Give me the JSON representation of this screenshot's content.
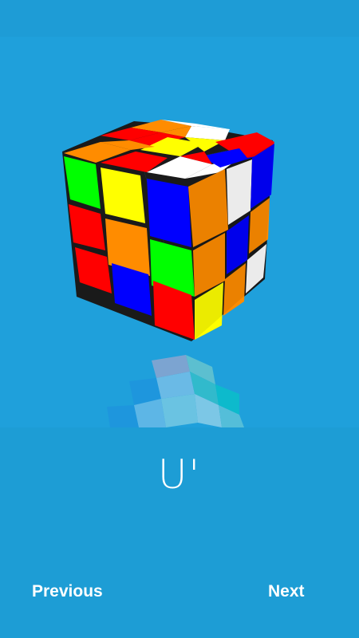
{
  "move": {
    "notation": "U'"
  },
  "navigation": {
    "previous_label": "Previous",
    "next_label": "Next"
  },
  "colors": {
    "background": "#1fa0db",
    "top_bar": "#1e9cd6",
    "bottom_panel": "#1d9dd5",
    "text": "#ffffff",
    "cube_red": "#ff0000",
    "cube_orange": "#ff8c00",
    "cube_yellow": "#ffff00",
    "cube_green": "#00ff00",
    "cube_blue": "#0000ff",
    "cube_white": "#ffffff"
  },
  "cube": {
    "left_face": [
      [
        "green",
        "yellow",
        "blue"
      ],
      [
        "red",
        "orange",
        "green"
      ],
      [
        "red",
        "blue",
        "red"
      ]
    ],
    "right_face": [
      [
        "orange",
        "white",
        "blue"
      ],
      [
        "orange",
        "blue",
        "orange"
      ],
      [
        "yellow",
        "orange",
        "white"
      ]
    ],
    "top_face": [
      [
        "orange",
        "orange",
        "white"
      ],
      [
        "red",
        "yellow",
        "red"
      ],
      [
        "red",
        "yellow",
        "blue"
      ],
      [
        "white"
      ]
    ]
  }
}
